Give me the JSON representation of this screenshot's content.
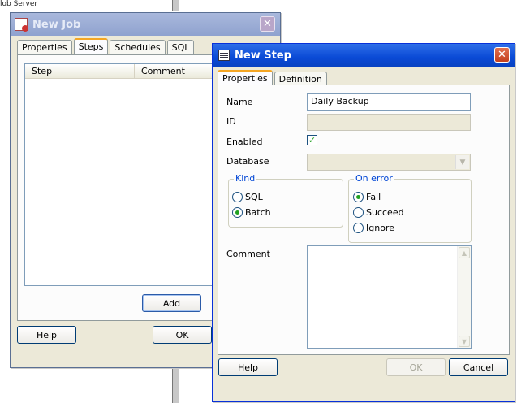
{
  "background": {
    "label": "lob Server"
  },
  "job_window": {
    "title": "New Job",
    "tabs": [
      "Properties",
      "Steps",
      "Schedules",
      "SQL"
    ],
    "active_tab": "Steps",
    "steps_list": {
      "columns": [
        "Step",
        "Comment"
      ],
      "rows": []
    },
    "buttons": {
      "add": "Add",
      "help": "Help",
      "ok": "OK"
    }
  },
  "step_window": {
    "title": "New Step",
    "tabs": [
      "Properties",
      "Definition"
    ],
    "active_tab": "Properties",
    "fields": {
      "name_label": "Name",
      "name_value": "Daily Backup",
      "id_label": "ID",
      "id_value": "",
      "enabled_label": "Enabled",
      "enabled_checked": true,
      "database_label": "Database",
      "database_value": "",
      "comment_label": "Comment",
      "comment_value": ""
    },
    "kind_group": {
      "title": "Kind",
      "options": [
        "SQL",
        "Batch"
      ],
      "selected": "Batch"
    },
    "on_error_group": {
      "title": "On error",
      "options": [
        "Fail",
        "Succeed",
        "Ignore"
      ],
      "selected": "Fail"
    },
    "buttons": {
      "help": "Help",
      "ok": "OK",
      "cancel": "Cancel",
      "ok_disabled": true
    }
  },
  "colors": {
    "active_title": "#0a4ad6",
    "inactive_title": "#8fa2cf",
    "dialog_face": "#ece9d8",
    "group_title": "#0046d5",
    "check_green": "#21a121"
  }
}
